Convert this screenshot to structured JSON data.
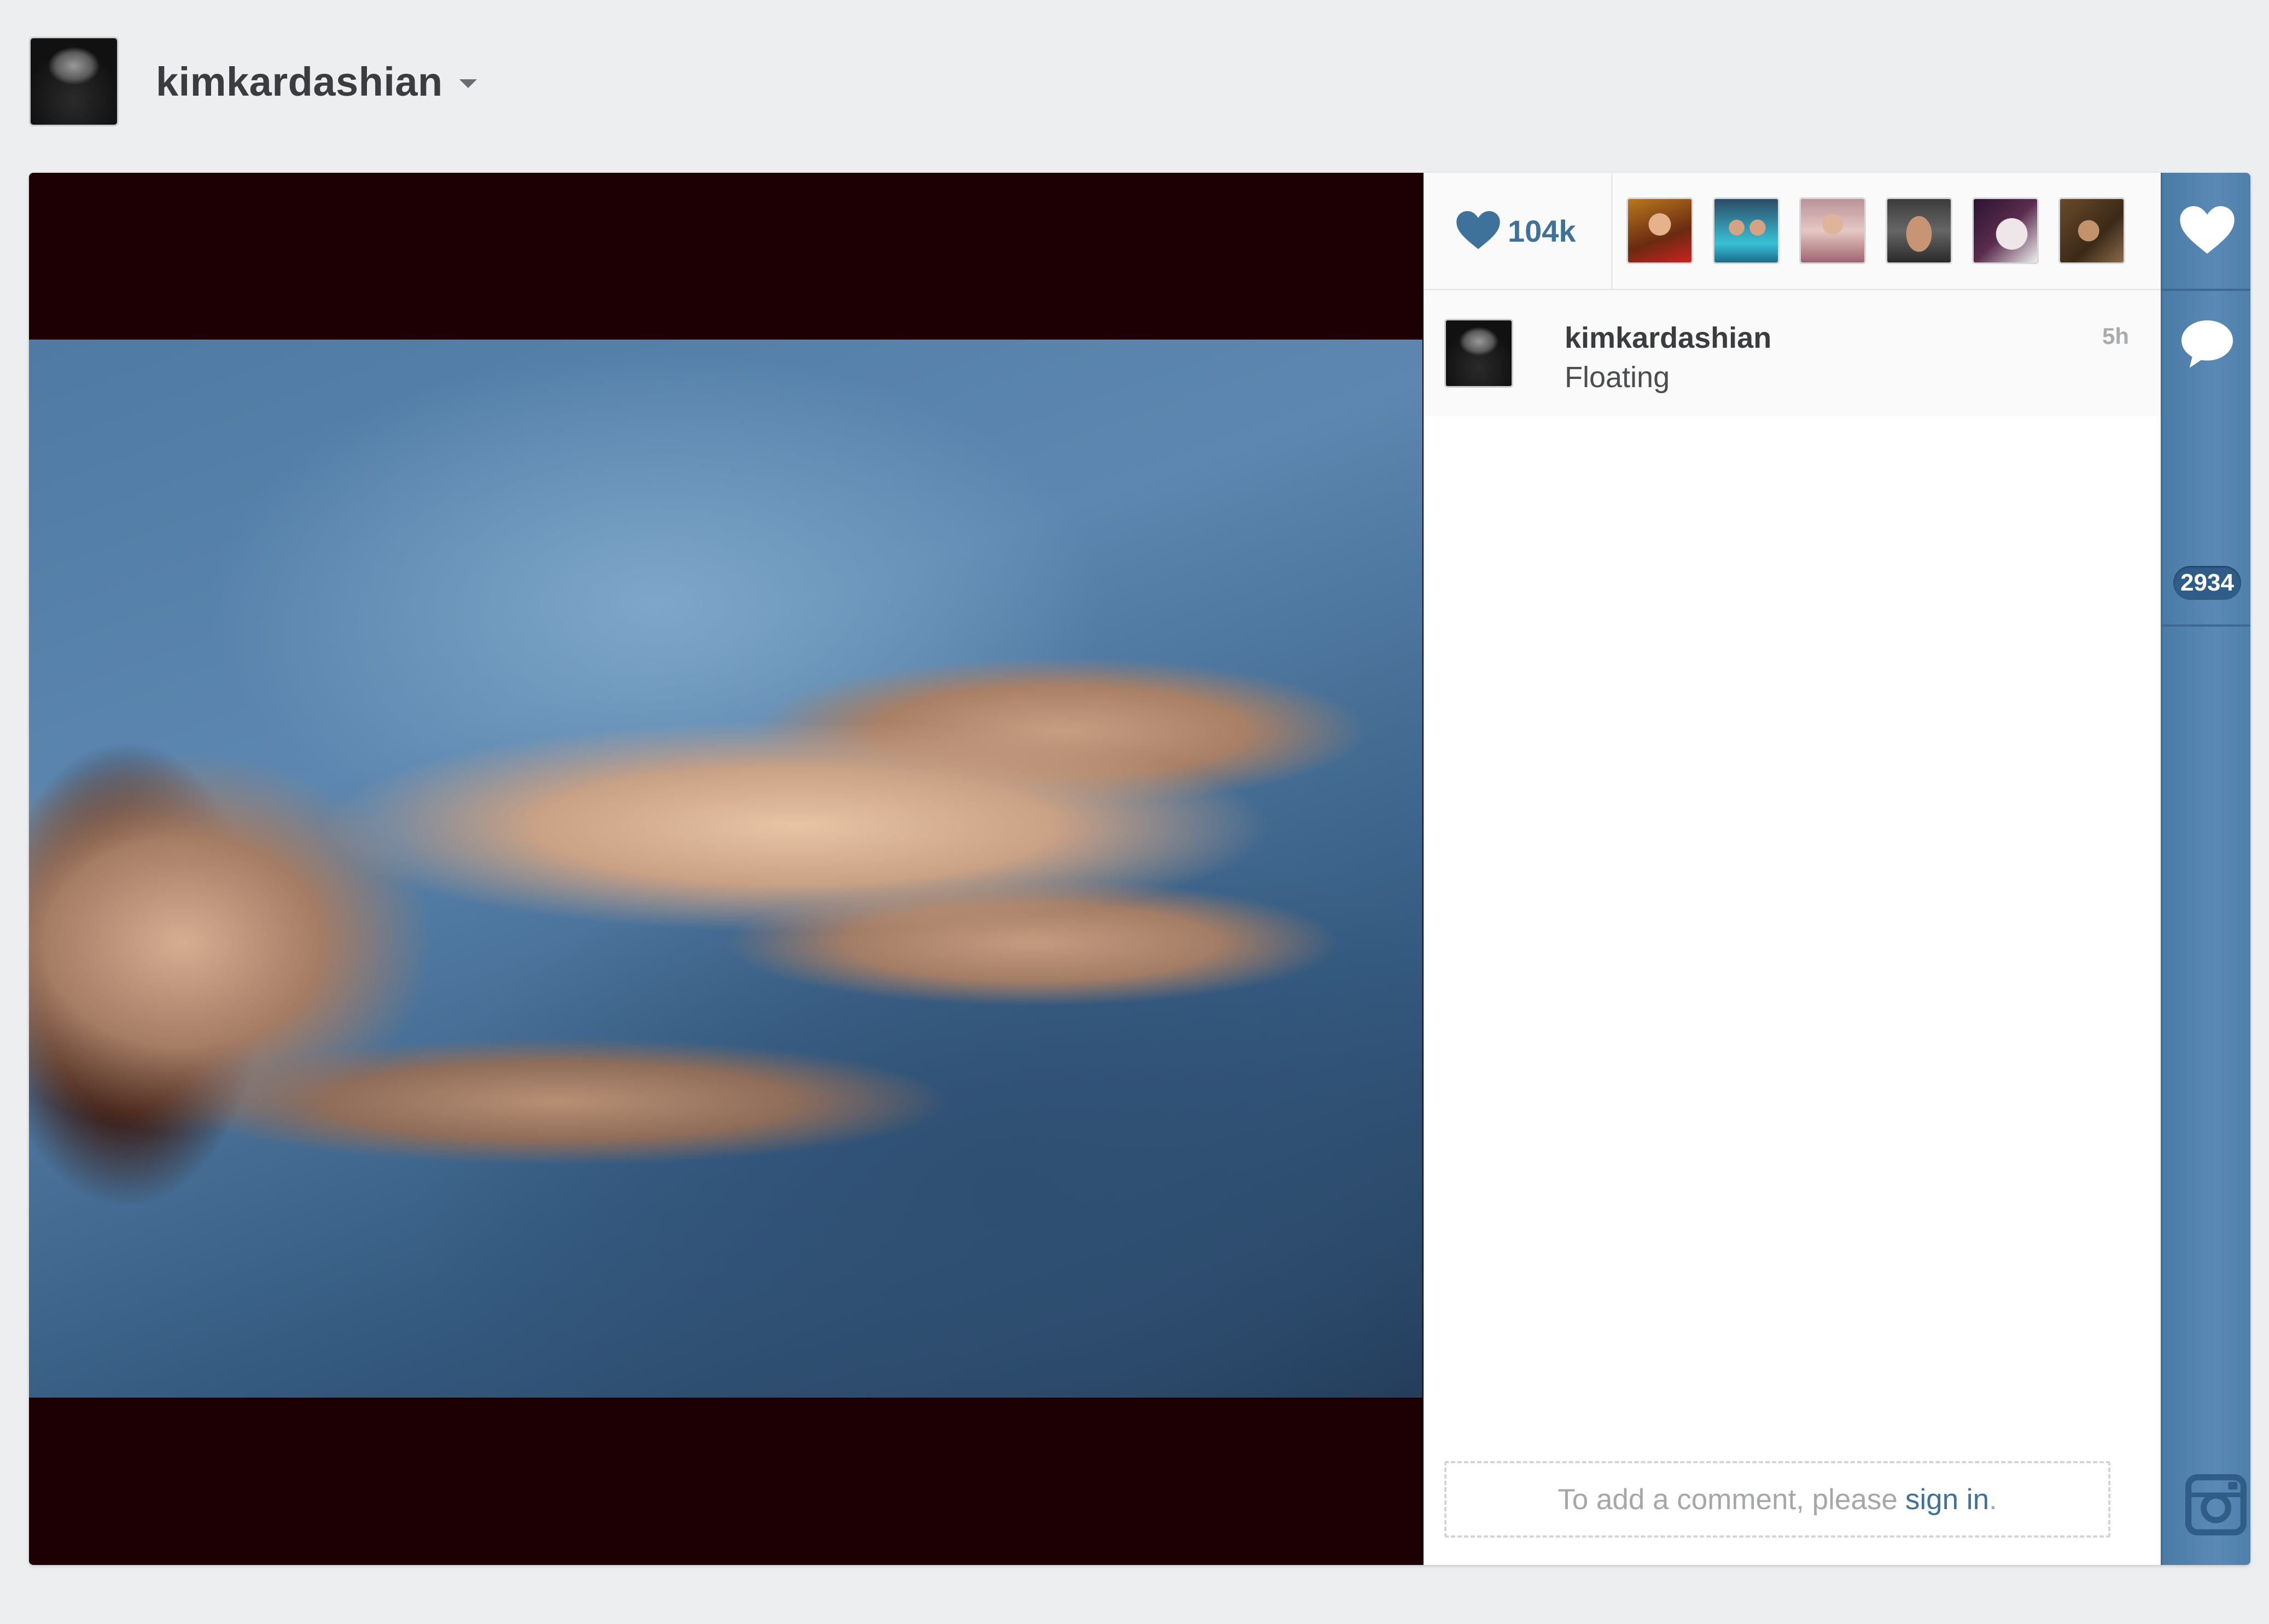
{
  "header": {
    "username": "kimkardashian",
    "avatar_icon": "profile-photo",
    "dropdown_icon": "caret-down-icon"
  },
  "media": {
    "description_icon": "post-photo"
  },
  "likes": {
    "count": "104k",
    "icon": "heart-icon",
    "likers": [
      "liker-1",
      "liker-2",
      "liker-3",
      "liker-4",
      "liker-5",
      "liker-6"
    ]
  },
  "caption": {
    "username": "kimkardashian",
    "text": "Floating",
    "time": "5h"
  },
  "comment_box": {
    "prompt": "To add a comment, please",
    "link": "sign in",
    "suffix": "."
  },
  "rail": {
    "like_icon": "heart-icon",
    "comment_icon": "speech-bubble-icon",
    "comment_count": "2934",
    "logo_icon": "instagram-logo-icon"
  },
  "colors": {
    "accent": "#3f729b",
    "rail": "#5a89b5",
    "rail_badge": "#2f5d88",
    "media_bg": "#1d0004",
    "page_bg": "#eceef0"
  }
}
